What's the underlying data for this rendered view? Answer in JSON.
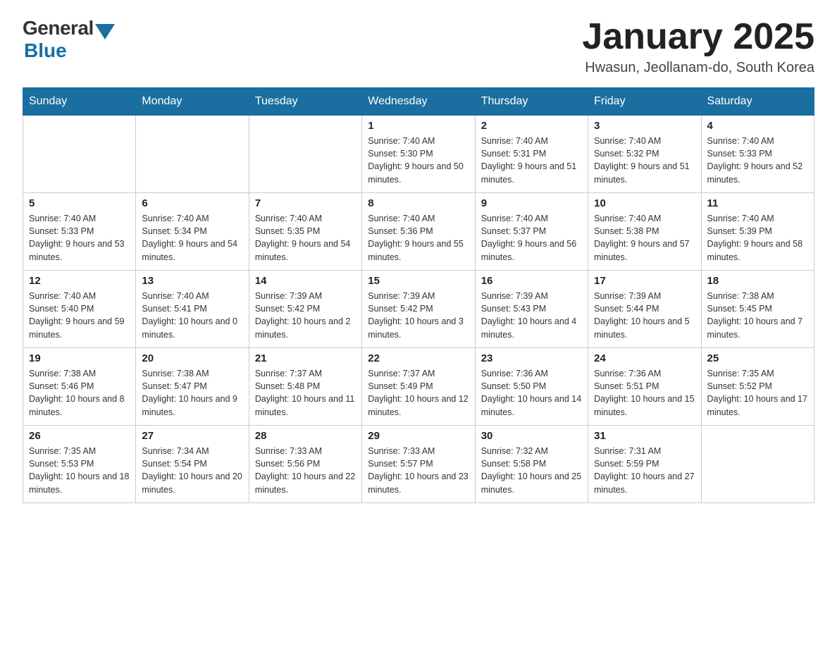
{
  "logo": {
    "general": "General",
    "blue": "Blue"
  },
  "title": "January 2025",
  "subtitle": "Hwasun, Jeollanam-do, South Korea",
  "headers": [
    "Sunday",
    "Monday",
    "Tuesday",
    "Wednesday",
    "Thursday",
    "Friday",
    "Saturday"
  ],
  "weeks": [
    [
      {
        "day": "",
        "info": ""
      },
      {
        "day": "",
        "info": ""
      },
      {
        "day": "",
        "info": ""
      },
      {
        "day": "1",
        "info": "Sunrise: 7:40 AM\nSunset: 5:30 PM\nDaylight: 9 hours and 50 minutes."
      },
      {
        "day": "2",
        "info": "Sunrise: 7:40 AM\nSunset: 5:31 PM\nDaylight: 9 hours and 51 minutes."
      },
      {
        "day": "3",
        "info": "Sunrise: 7:40 AM\nSunset: 5:32 PM\nDaylight: 9 hours and 51 minutes."
      },
      {
        "day": "4",
        "info": "Sunrise: 7:40 AM\nSunset: 5:33 PM\nDaylight: 9 hours and 52 minutes."
      }
    ],
    [
      {
        "day": "5",
        "info": "Sunrise: 7:40 AM\nSunset: 5:33 PM\nDaylight: 9 hours and 53 minutes."
      },
      {
        "day": "6",
        "info": "Sunrise: 7:40 AM\nSunset: 5:34 PM\nDaylight: 9 hours and 54 minutes."
      },
      {
        "day": "7",
        "info": "Sunrise: 7:40 AM\nSunset: 5:35 PM\nDaylight: 9 hours and 54 minutes."
      },
      {
        "day": "8",
        "info": "Sunrise: 7:40 AM\nSunset: 5:36 PM\nDaylight: 9 hours and 55 minutes."
      },
      {
        "day": "9",
        "info": "Sunrise: 7:40 AM\nSunset: 5:37 PM\nDaylight: 9 hours and 56 minutes."
      },
      {
        "day": "10",
        "info": "Sunrise: 7:40 AM\nSunset: 5:38 PM\nDaylight: 9 hours and 57 minutes."
      },
      {
        "day": "11",
        "info": "Sunrise: 7:40 AM\nSunset: 5:39 PM\nDaylight: 9 hours and 58 minutes."
      }
    ],
    [
      {
        "day": "12",
        "info": "Sunrise: 7:40 AM\nSunset: 5:40 PM\nDaylight: 9 hours and 59 minutes."
      },
      {
        "day": "13",
        "info": "Sunrise: 7:40 AM\nSunset: 5:41 PM\nDaylight: 10 hours and 0 minutes."
      },
      {
        "day": "14",
        "info": "Sunrise: 7:39 AM\nSunset: 5:42 PM\nDaylight: 10 hours and 2 minutes."
      },
      {
        "day": "15",
        "info": "Sunrise: 7:39 AM\nSunset: 5:42 PM\nDaylight: 10 hours and 3 minutes."
      },
      {
        "day": "16",
        "info": "Sunrise: 7:39 AM\nSunset: 5:43 PM\nDaylight: 10 hours and 4 minutes."
      },
      {
        "day": "17",
        "info": "Sunrise: 7:39 AM\nSunset: 5:44 PM\nDaylight: 10 hours and 5 minutes."
      },
      {
        "day": "18",
        "info": "Sunrise: 7:38 AM\nSunset: 5:45 PM\nDaylight: 10 hours and 7 minutes."
      }
    ],
    [
      {
        "day": "19",
        "info": "Sunrise: 7:38 AM\nSunset: 5:46 PM\nDaylight: 10 hours and 8 minutes."
      },
      {
        "day": "20",
        "info": "Sunrise: 7:38 AM\nSunset: 5:47 PM\nDaylight: 10 hours and 9 minutes."
      },
      {
        "day": "21",
        "info": "Sunrise: 7:37 AM\nSunset: 5:48 PM\nDaylight: 10 hours and 11 minutes."
      },
      {
        "day": "22",
        "info": "Sunrise: 7:37 AM\nSunset: 5:49 PM\nDaylight: 10 hours and 12 minutes."
      },
      {
        "day": "23",
        "info": "Sunrise: 7:36 AM\nSunset: 5:50 PM\nDaylight: 10 hours and 14 minutes."
      },
      {
        "day": "24",
        "info": "Sunrise: 7:36 AM\nSunset: 5:51 PM\nDaylight: 10 hours and 15 minutes."
      },
      {
        "day": "25",
        "info": "Sunrise: 7:35 AM\nSunset: 5:52 PM\nDaylight: 10 hours and 17 minutes."
      }
    ],
    [
      {
        "day": "26",
        "info": "Sunrise: 7:35 AM\nSunset: 5:53 PM\nDaylight: 10 hours and 18 minutes."
      },
      {
        "day": "27",
        "info": "Sunrise: 7:34 AM\nSunset: 5:54 PM\nDaylight: 10 hours and 20 minutes."
      },
      {
        "day": "28",
        "info": "Sunrise: 7:33 AM\nSunset: 5:56 PM\nDaylight: 10 hours and 22 minutes."
      },
      {
        "day": "29",
        "info": "Sunrise: 7:33 AM\nSunset: 5:57 PM\nDaylight: 10 hours and 23 minutes."
      },
      {
        "day": "30",
        "info": "Sunrise: 7:32 AM\nSunset: 5:58 PM\nDaylight: 10 hours and 25 minutes."
      },
      {
        "day": "31",
        "info": "Sunrise: 7:31 AM\nSunset: 5:59 PM\nDaylight: 10 hours and 27 minutes."
      },
      {
        "day": "",
        "info": ""
      }
    ]
  ]
}
